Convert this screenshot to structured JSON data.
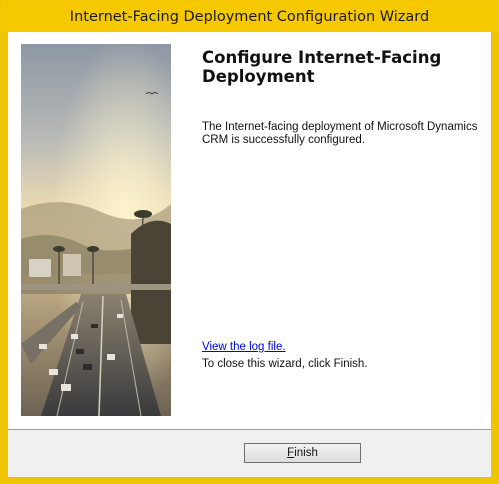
{
  "window": {
    "title": "Internet-Facing Deployment Configuration Wizard"
  },
  "page": {
    "heading": "Configure Internet-Facing Deployment",
    "description": "The Internet-facing deployment of Microsoft Dynamics CRM is successfully configured.",
    "log_link": "View the log file.",
    "close_hint": "To close this wizard, click Finish."
  },
  "footer": {
    "finish_label_mnemonic": "F",
    "finish_label_rest": "inish"
  },
  "colors": {
    "titlebar": "#f6c800",
    "link": "#0000ee",
    "footer_bg": "#f0f0f0"
  }
}
